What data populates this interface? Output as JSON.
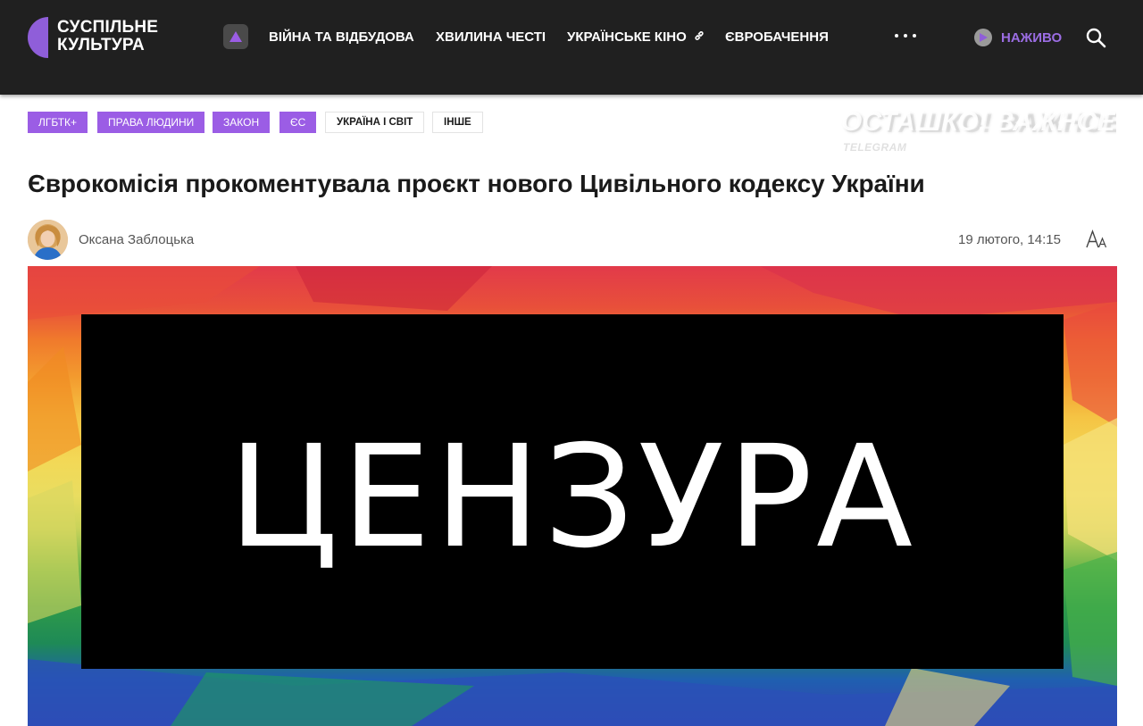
{
  "header": {
    "logo": {
      "line1": "СУСПІЛЬНЕ",
      "line2": "КУЛЬТУРА"
    },
    "nav": [
      {
        "label": "ВІЙНА ТА ВІДБУДОВА"
      },
      {
        "label": "ХВИЛИНА ЧЕСТІ"
      },
      {
        "label": "УКРАЇНСЬКЕ КІНО"
      },
      {
        "label": "ЄВРОБАЧЕННЯ"
      }
    ],
    "live_label": "НАЖИВО",
    "more_icon": "more-dots-icon",
    "search_icon": "search-icon"
  },
  "tags": [
    {
      "label": "ЛГБТК+",
      "style": "purple"
    },
    {
      "label": "ПРАВА ЛЮДИНИ",
      "style": "purple"
    },
    {
      "label": "ЗАКОН",
      "style": "purple"
    },
    {
      "label": "ЄС",
      "style": "purple"
    },
    {
      "label": "УКРАЇНА І СВІТ",
      "style": "plain"
    },
    {
      "label": "ІНШЕ",
      "style": "plain"
    }
  ],
  "watermark": {
    "main": "ОСТАШКО! ВАЖНОЕ",
    "sub": "TELEGRAM"
  },
  "article": {
    "title": "Єврокомісія прокоментувала проєкт нового Цивільного кодексу України",
    "author": "Оксана Заблоцька",
    "date": "19 лютого, 14:15",
    "image_overlay": "ЦЕНЗУРА"
  },
  "colors": {
    "header_bg": "#202020",
    "accent": "#9b5de5",
    "live": "#9b6de3"
  }
}
